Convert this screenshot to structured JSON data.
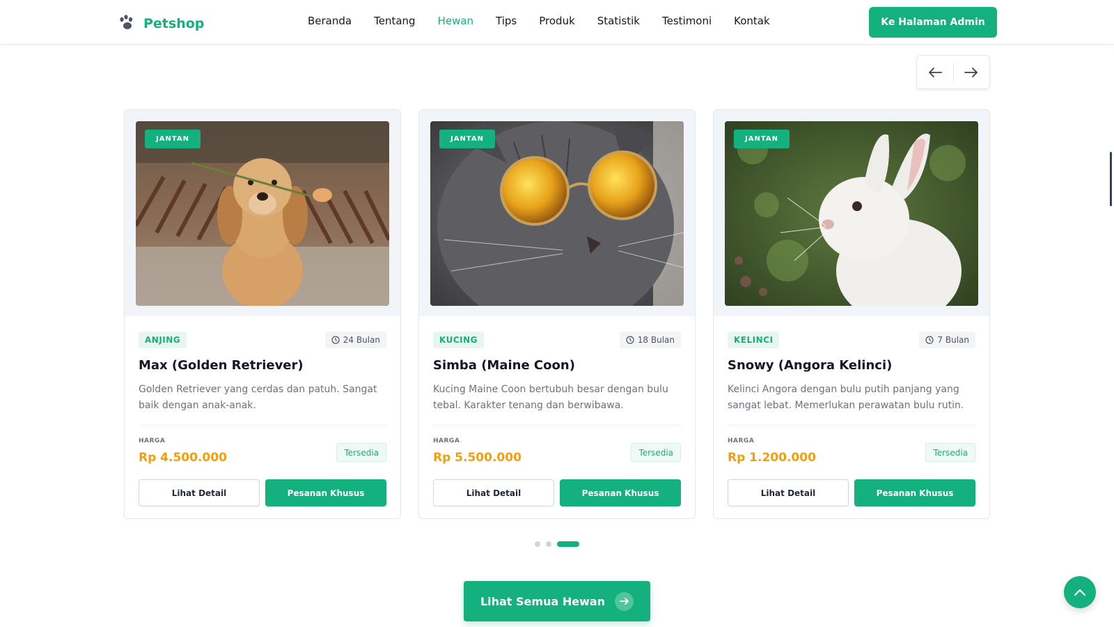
{
  "brand": {
    "name": "Petshop",
    "icon": "paw-icon",
    "color": "#14b07d"
  },
  "nav": {
    "links": [
      "Beranda",
      "Tentang",
      "Hewan",
      "Tips",
      "Produk",
      "Statistik",
      "Testimoni",
      "Kontak"
    ],
    "active": "Hewan"
  },
  "admin_button": "Ke Halaman Admin",
  "carousel": {
    "prev_icon": "arrow-left-icon",
    "next_icon": "arrow-right-icon",
    "active_dot": 3,
    "dot_count": 3
  },
  "pets": [
    {
      "gender": "JANTAN",
      "species": "ANJING",
      "age": "24 Bulan",
      "name": "Max (Golden Retriever)",
      "description": "Golden Retriever yang cerdas dan patuh. Sangat baik dengan anak-anak.",
      "price_label": "HARGA",
      "price": "Rp 4.500.000",
      "status": "Tersedia",
      "detail_label": "Lihat Detail",
      "order_label": "Pesanan Khusus"
    },
    {
      "gender": "JANTAN",
      "species": "KUCING",
      "age": "18 Bulan",
      "name": "Simba (Maine Coon)",
      "description": "Kucing Maine Coon bertubuh besar dengan bulu tebal. Karakter tenang dan berwibawa.",
      "price_label": "HARGA",
      "price": "Rp 5.500.000",
      "status": "Tersedia",
      "detail_label": "Lihat Detail",
      "order_label": "Pesanan Khusus"
    },
    {
      "gender": "JANTAN",
      "species": "KELINCI",
      "age": "7 Bulan",
      "name": "Snowy (Angora Kelinci)",
      "description": "Kelinci Angora dengan bulu putih panjang yang sangat lebat. Memerlukan perawatan bulu rutin.",
      "price_label": "HARGA",
      "price": "Rp 1.200.000",
      "status": "Tersedia",
      "detail_label": "Lihat Detail",
      "order_label": "Pesanan Khusus"
    }
  ],
  "see_all_button": "Lihat Semua Hewan",
  "colors": {
    "primary": "#14b07d",
    "price": "#f59e0b"
  }
}
